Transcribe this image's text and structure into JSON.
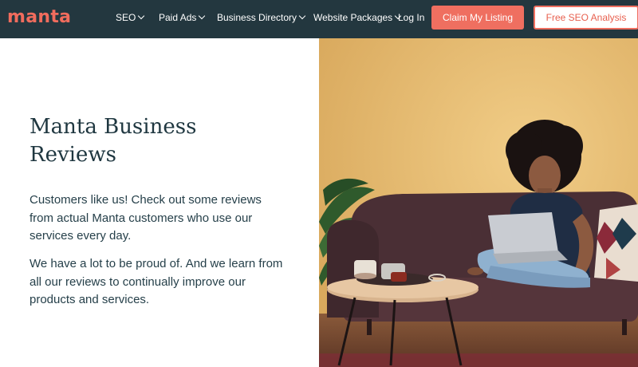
{
  "nav": {
    "logo": "manta",
    "items": [
      {
        "label": "SEO",
        "has_dropdown": true
      },
      {
        "label": "Paid Ads",
        "has_dropdown": true
      },
      {
        "label": "Business Directory",
        "has_dropdown": true
      },
      {
        "label": "Website Packages",
        "has_dropdown": true
      },
      {
        "label": "Log In",
        "has_dropdown": false
      }
    ],
    "claim_button": "Claim My Listing",
    "seo_button": "Free SEO Analysis"
  },
  "main": {
    "title": "Manta Business Reviews",
    "paragraph_1": "Customers like us! Check out some reviews from actual Manta customers who use our services every day.",
    "paragraph_2": "We have a lot to be proud of. And we learn from all our reviews to continually improve our products and services."
  },
  "colors": {
    "nav_bg": "#23373f",
    "brand_coral": "#ef6f60",
    "heading": "#1f3740",
    "wall": "#ecc27a"
  }
}
